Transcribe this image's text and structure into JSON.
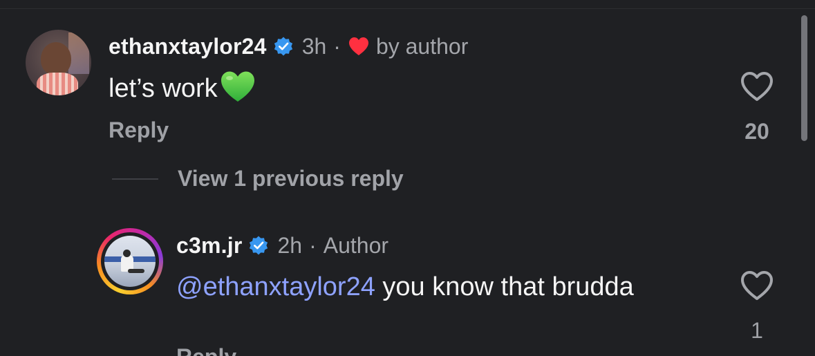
{
  "comments": [
    {
      "username": "ethanxtaylor24",
      "verified": true,
      "time": "3h",
      "separator": "·",
      "liked_by_author": "by author",
      "text": "let’s work",
      "emoji": "green-heart",
      "reply_label": "Reply",
      "like_count": "20"
    }
  ],
  "view_previous": "View 1 previous reply",
  "replies": [
    {
      "username": "c3m.jr",
      "verified": true,
      "time": "2h",
      "separator": "·",
      "role": "Author",
      "mention": "@ethanxtaylor24",
      "text": " you know that brudda",
      "reply_label": "Reply",
      "like_count": "1"
    }
  ],
  "colors": {
    "background": "#1f2023",
    "verified_badge": "#3897f0",
    "heart_red": "#ff3040",
    "mention": "#8ea2ff",
    "muted_text": "#a4a6ab"
  }
}
